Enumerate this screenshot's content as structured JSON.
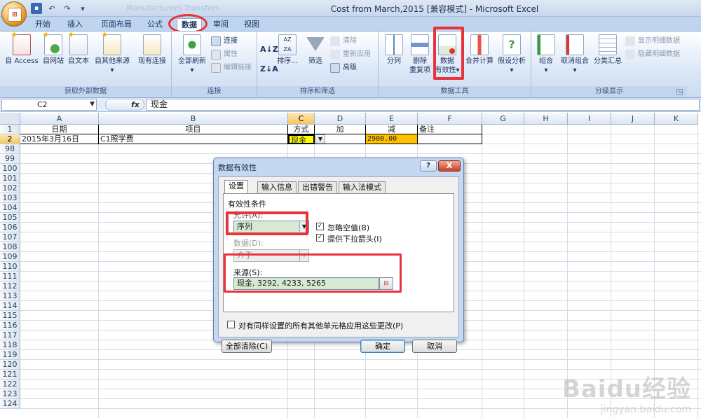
{
  "window": {
    "title": "Cost from March,2015  [兼容模式] - Microsoft Excel",
    "ghost_text": "Manufacturers Transfers"
  },
  "ribbon_tabs": [
    {
      "label": "开始"
    },
    {
      "label": "插入"
    },
    {
      "label": "页面布局"
    },
    {
      "label": "公式"
    },
    {
      "label": "数据"
    },
    {
      "label": "审阅"
    },
    {
      "label": "视图"
    }
  ],
  "ribbon": {
    "external": {
      "label": "获取外部数据",
      "access": "自 Access",
      "web": "自网站",
      "text": "自文本",
      "other": "自其他来源",
      "existing": "现有连接"
    },
    "connections": {
      "label": "连接",
      "refresh_all": "全部刷新",
      "connections": "连接",
      "properties": "属性",
      "edit_links": "编辑链接"
    },
    "sort_filter": {
      "label": "排序和筛选",
      "sort": "排序...",
      "filter": "筛选",
      "clear": "清除",
      "reapply": "重新应用",
      "advanced": "高级"
    },
    "data_tools": {
      "label": "数据工具",
      "text_to_columns": "分列",
      "remove_dup_1": "删除",
      "remove_dup_2": "重复项",
      "validation_1": "数据",
      "validation_2": "有效性",
      "consolidate": "合并计算",
      "what_if": "假设分析"
    },
    "outline": {
      "label": "分级显示",
      "group": "组合",
      "ungroup": "取消组合",
      "subtotal": "分类汇总",
      "show_detail": "显示明细数据",
      "hide_detail": "隐藏明细数据"
    }
  },
  "formula_bar": {
    "name_box": "C2",
    "fx": "fx",
    "value": "现金"
  },
  "sheet": {
    "columns": [
      "A",
      "B",
      "C",
      "D",
      "E",
      "F",
      "G",
      "H",
      "I",
      "J",
      "K"
    ],
    "rows": [
      "1",
      "2",
      "98",
      "99",
      "100",
      "101",
      "102",
      "103",
      "104",
      "105",
      "106",
      "107",
      "108",
      "109",
      "110",
      "111",
      "112",
      "113",
      "114",
      "115",
      "116",
      "117",
      "118",
      "119",
      "120",
      "121",
      "122",
      "123",
      "124"
    ],
    "header_row": [
      "日期",
      "项目",
      "方式",
      "加",
      "减",
      "备注"
    ],
    "data_row": [
      "2015年3月16日",
      "C1照学费",
      "现金",
      "",
      "2900.00",
      ""
    ]
  },
  "dialog": {
    "title": "数据有效性",
    "help": "?",
    "close": "X",
    "tabs": [
      "设置",
      "输入信息",
      "出错警告",
      "输入法模式"
    ],
    "criteria_label": "有效性条件",
    "allow_label": "允许(A):",
    "allow_value": "序列",
    "ignore_blank": "忽略空值(B)",
    "in_cell_dropdown": "提供下拉箭头(I)",
    "data_label": "数据(D):",
    "data_value": "介于",
    "source_label": "来源(S):",
    "source_value": "现金, 3292, 4233, 5265",
    "apply_all": "对有同样设置的所有其他单元格应用这些更改(P)",
    "clear_all": "全部清除(C)",
    "ok": "确定",
    "cancel": "取消"
  },
  "watermark": {
    "main": "Baidu经验",
    "sub": "jingyan.baidu.com"
  }
}
